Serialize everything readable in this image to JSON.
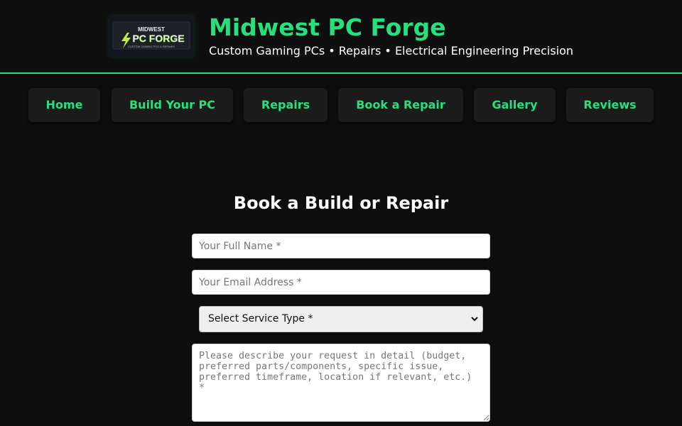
{
  "header": {
    "logo": {
      "line1": "MIDWEST",
      "line2": "PC FORGE",
      "line3": "CUSTOM GAMING PCS & REPAIRS",
      "icon": "lightning-bolt-icon"
    },
    "title": "Midwest PC Forge",
    "tagline": "Custom Gaming PCs • Repairs • Electrical Engineering Precision"
  },
  "nav": {
    "items": [
      {
        "label": "Home"
      },
      {
        "label": "Build Your PC"
      },
      {
        "label": "Repairs"
      },
      {
        "label": "Book a Repair"
      },
      {
        "label": "Gallery"
      },
      {
        "label": "Reviews"
      }
    ]
  },
  "form": {
    "title": "Book a Build or Repair",
    "name_placeholder": "Your Full Name *",
    "name_value": "",
    "email_placeholder": "Your Email Address *",
    "email_value": "",
    "service_selected": "Select Service Type *",
    "details_placeholder": "Please describe your request in detail (budget, preferred parts/components, specific issue, preferred timeframe, location if relevant, etc.) *",
    "details_value": ""
  },
  "colors": {
    "accent": "#25e07c",
    "background": "#0d0d0d",
    "header_background": "#0f0f0f",
    "nav_button": "#1b1b1b",
    "text": "#ffffff"
  }
}
